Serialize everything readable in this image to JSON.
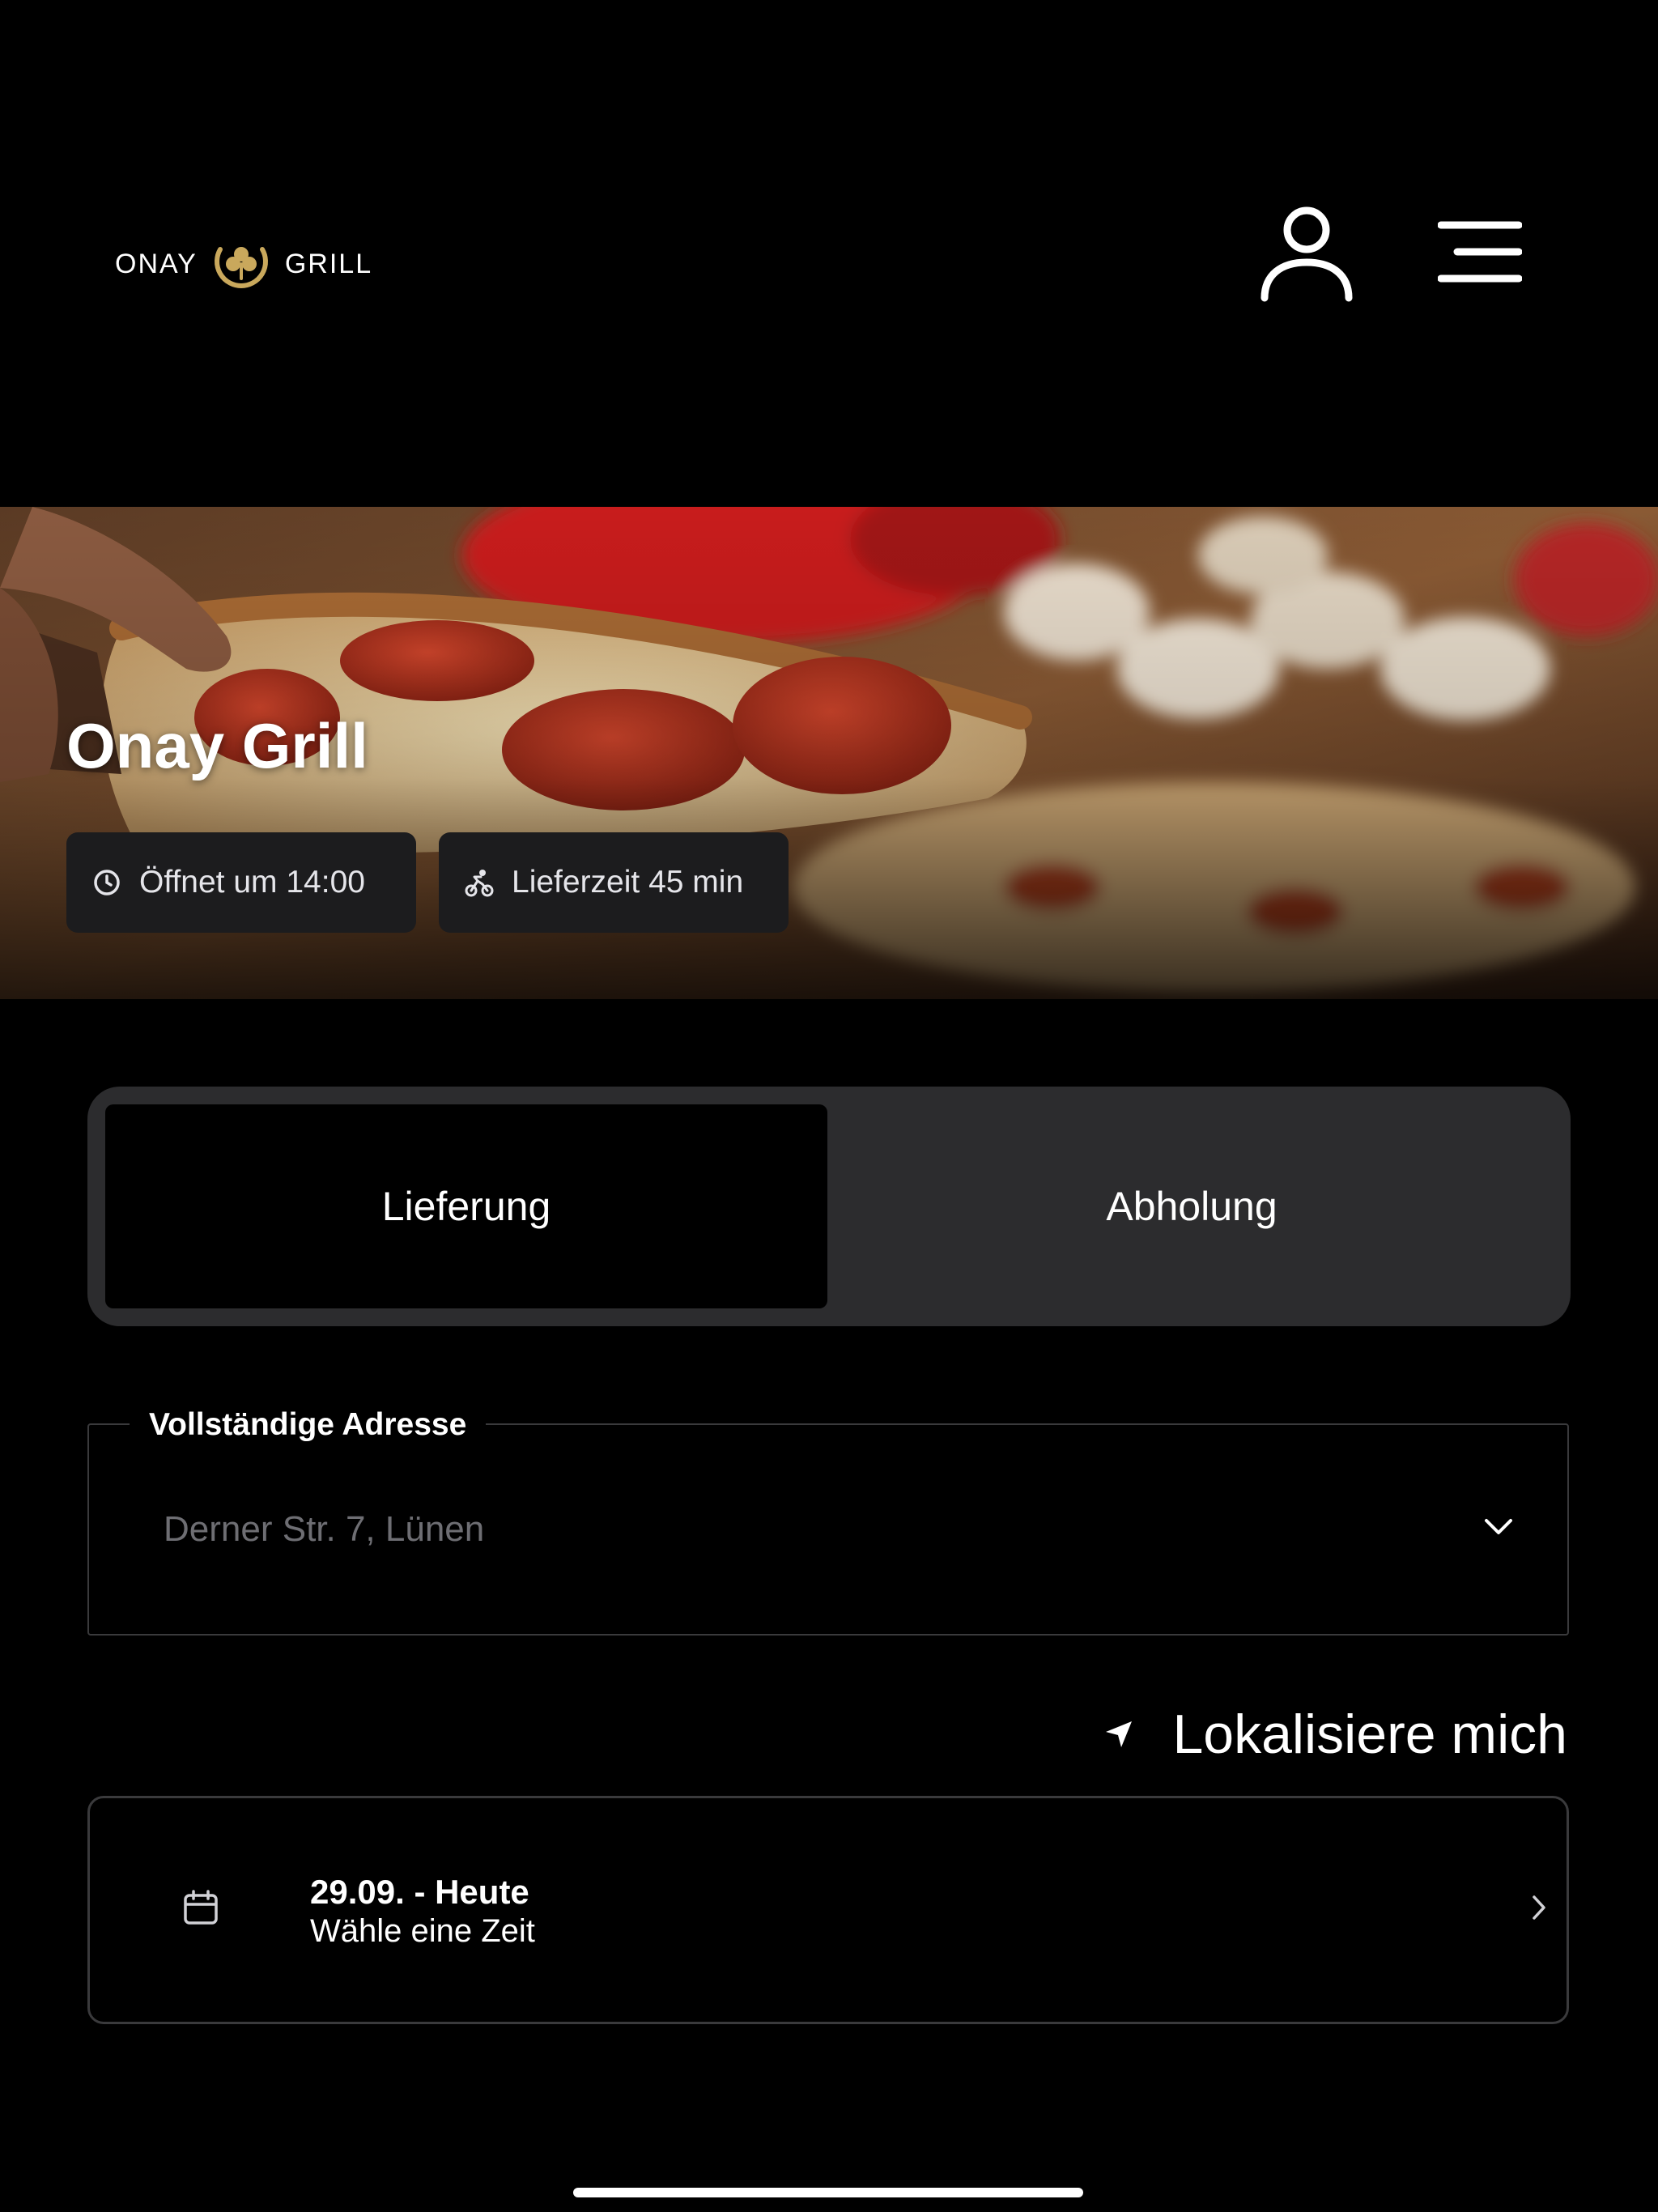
{
  "header": {
    "logo": {
      "left_text": "ONAY",
      "right_text": "GRILL",
      "emblem": "shamrock-emblem-icon"
    },
    "user_icon": "user-icon",
    "menu_icon": "hamburger-menu-icon"
  },
  "hero": {
    "title": "Onay Grill",
    "chips": {
      "hours": {
        "icon": "clock-icon",
        "label": "Öffnet um 14:00"
      },
      "delivery_time": {
        "icon": "cyclist-icon",
        "label": "Lieferzeit 45 min"
      }
    }
  },
  "order_mode": {
    "options": [
      "Lieferung",
      "Abholung"
    ],
    "selected": "Lieferung"
  },
  "address": {
    "label": "Vollständige Adresse",
    "placeholder": "Derner Str. 7, Lünen",
    "icon": "chevron-down-icon"
  },
  "locate": {
    "label": "Lokalisiere mich",
    "icon": "location-arrow-icon"
  },
  "time_picker": {
    "date": "29.09. - Heute",
    "hint": "Wähle eine Zeit",
    "icon": "calendar-icon",
    "chevron": "chevron-right-icon"
  },
  "colors": {
    "background": "#000000",
    "surface": "#2c2c2e",
    "chip": "#1c1c1e",
    "border": "#3a3a3c",
    "logo_gold": "#c9a85c",
    "placeholder": "#6e6e73"
  }
}
